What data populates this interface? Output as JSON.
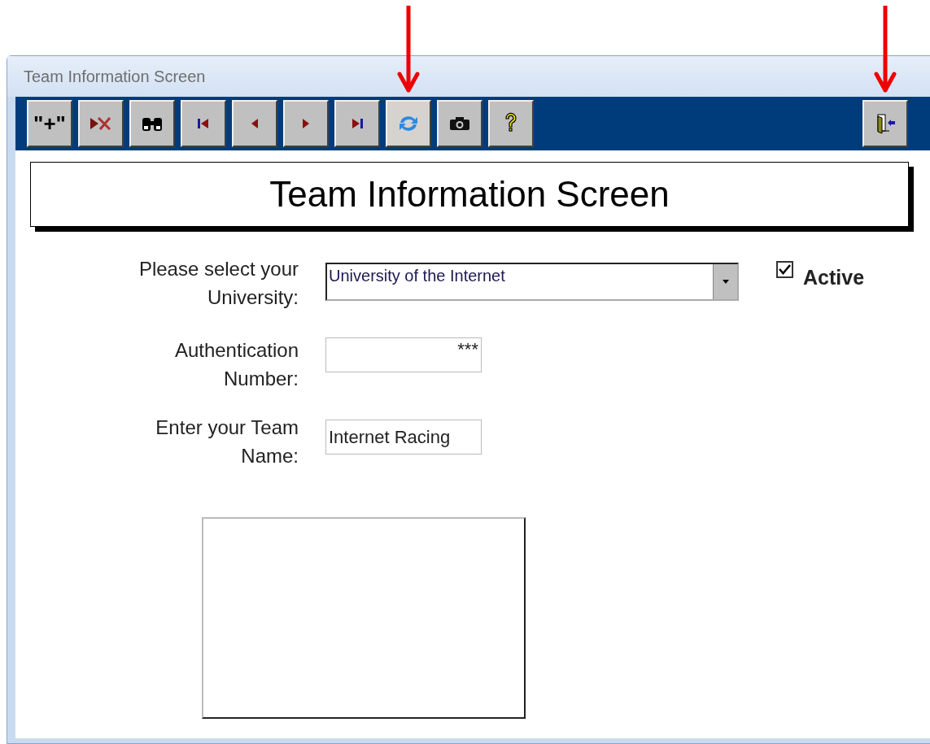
{
  "window": {
    "title": "Team Information Screen"
  },
  "toolbar": {
    "buttons": [
      {
        "kind": "text",
        "label": "\"+\"",
        "highlighted": false,
        "arrow": false
      },
      {
        "kind": "delete",
        "highlighted": false,
        "arrow": false
      },
      {
        "kind": "find",
        "highlighted": false,
        "arrow": false
      },
      {
        "kind": "first",
        "highlighted": false,
        "arrow": false
      },
      {
        "kind": "previous",
        "highlighted": false,
        "arrow": false
      },
      {
        "kind": "next",
        "highlighted": false,
        "arrow": false
      },
      {
        "kind": "last",
        "highlighted": false,
        "arrow": false
      },
      {
        "kind": "refresh",
        "highlighted": true,
        "arrow": true
      },
      {
        "kind": "camera",
        "highlighted": false,
        "arrow": false
      },
      {
        "kind": "help",
        "highlighted": false,
        "arrow": false
      }
    ],
    "exit_button": {
      "kind": "exit",
      "highlighted": false,
      "arrow": true
    }
  },
  "heading": "Team Information Screen",
  "form": {
    "university": {
      "label": "Please select your University:",
      "value": "University of the Internet"
    },
    "active": {
      "label": "Active",
      "checked": true
    },
    "authentication": {
      "label": "Authentication Number:",
      "value": "***"
    },
    "team_name": {
      "label": "Enter your Team Name:",
      "value": "Internet Racing"
    },
    "photo_frame": {
      "kind": "empty"
    }
  }
}
